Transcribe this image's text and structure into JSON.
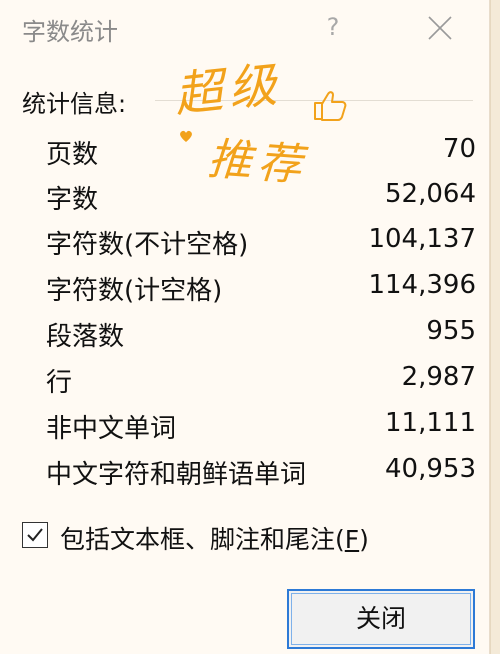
{
  "window": {
    "title": "字数统计",
    "help_label": "?"
  },
  "stats": {
    "section_label": "统计信息:",
    "rows": [
      {
        "label": "页数",
        "value": "70"
      },
      {
        "label": "字数",
        "value": "52,064"
      },
      {
        "label": "字符数(不计空格)",
        "value": "104,137"
      },
      {
        "label": "字符数(计空格)",
        "value": "114,396"
      },
      {
        "label": "段落数",
        "value": "955"
      },
      {
        "label": "行",
        "value": "2,987"
      },
      {
        "label": "非中文单词",
        "value": "11,111"
      },
      {
        "label": "中文字符和朝鲜语单词",
        "value": "40,953"
      }
    ]
  },
  "options": {
    "include_label_prefix": "包括文本框、脚注和尾注(",
    "include_label_key": "F",
    "include_label_suffix": ")",
    "include_checked": true
  },
  "footer": {
    "close_label": "关闭"
  },
  "sticker": {
    "line1": "超级",
    "line2": "推荐",
    "icons": [
      "thumbs-up-icon",
      "heart-icon"
    ]
  },
  "colors": {
    "accent": "#2d7ad6",
    "sticker": "#f2a21b",
    "background": "#fffaf3"
  }
}
